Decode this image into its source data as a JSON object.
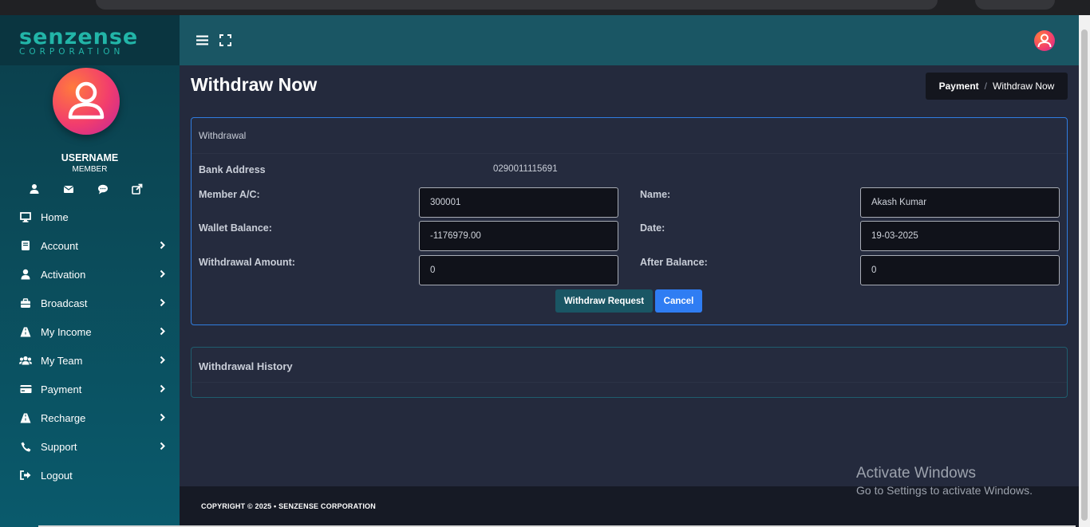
{
  "brand": {
    "logo_main": "senzense",
    "logo_sub": "CORPORATION"
  },
  "user": {
    "name": "USERNAME",
    "role": "MEMBER"
  },
  "quick_icons": [
    "user-icon",
    "mail-icon",
    "chat-icon",
    "share-icon"
  ],
  "sidebar": {
    "items": [
      {
        "label": "Home",
        "icon": "monitor-icon"
      },
      {
        "label": "Account",
        "icon": "book-icon"
      },
      {
        "label": "Activation",
        "icon": "user-icon"
      },
      {
        "label": "Broadcast",
        "icon": "briefcase-icon"
      },
      {
        "label": "My Income",
        "icon": "road-icon"
      },
      {
        "label": "My Team",
        "icon": "users-icon"
      },
      {
        "label": "Payment",
        "icon": "credit-card-icon"
      },
      {
        "label": "Recharge",
        "icon": "road-icon"
      },
      {
        "label": "Support",
        "icon": "phone-icon"
      },
      {
        "label": "Logout",
        "icon": "sign-out-icon"
      }
    ]
  },
  "page": {
    "title": "Withdraw Now",
    "breadcrumb": {
      "parent": "Payment",
      "separator": "/",
      "current": "Withdraw Now"
    }
  },
  "withdrawal": {
    "header": "Withdrawal",
    "bank_address_label": "Bank Address",
    "bank_address_value": "0290011115691",
    "member_ac_label": "Member A/C:",
    "member_ac_value": "300001",
    "name_label": "Name:",
    "name_value": "Akash Kumar",
    "wallet_balance_label": "Wallet Balance:",
    "wallet_balance_value": "-1176979.00",
    "date_label": "Date:",
    "date_value": "19-03-2025",
    "withdrawal_amount_label": "Withdrawal Amount:",
    "withdrawal_amount_value": "0",
    "after_balance_label": "After Balance:",
    "after_balance_value": "0",
    "withdraw_button": "Withdraw Request",
    "cancel_button": "Cancel"
  },
  "history": {
    "header": "Withdrawal History"
  },
  "footer": {
    "copyright": "COPYRIGHT © 2025  •  SENZENSE CORPORATION"
  },
  "watermark": {
    "line1": "Activate Windows",
    "line2": "Go to Settings to activate Windows."
  },
  "colors": {
    "sidebar": "#0b4a58",
    "topbar": "#1a5664",
    "primary": "#2f7df3",
    "background": "#242a3d"
  }
}
